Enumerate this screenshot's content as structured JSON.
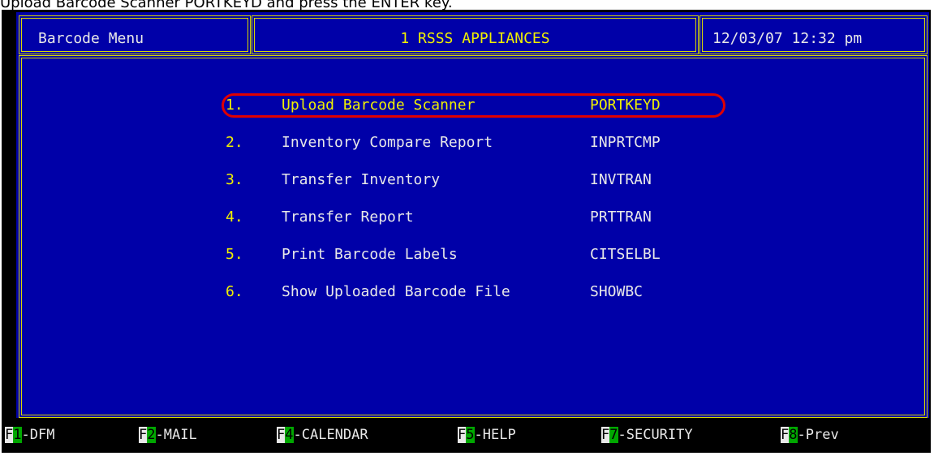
{
  "caption": "Upload Barcode Scanner PORTKEYD and press the ENTER key.",
  "header": {
    "menu_title": "Barcode Menu",
    "company": "1 RSSS APPLIANCES",
    "datetime": "12/03/07 12:32 pm"
  },
  "menu": {
    "items": [
      {
        "num": "1.",
        "label": "Upload Barcode Scanner",
        "code": "PORTKEYD",
        "selected": true
      },
      {
        "num": "2.",
        "label": "Inventory Compare Report",
        "code": "INPRTCMP"
      },
      {
        "num": "3.",
        "label": "Transfer Inventory",
        "code": "INVTRAN"
      },
      {
        "num": "4.",
        "label": "Transfer Report",
        "code": "PRTTRAN"
      },
      {
        "num": "5.",
        "label": "Print Barcode Labels",
        "code": "CITSELBL"
      },
      {
        "num": "6.",
        "label": "Show Uploaded Barcode File",
        "code": "SHOWBC"
      }
    ]
  },
  "function_keys": [
    {
      "key": "F",
      "num": "1",
      "label": "-DFM"
    },
    {
      "key": "F",
      "num": "2",
      "label": "-MAIL"
    },
    {
      "key": "F",
      "num": "4",
      "label": "-CALENDAR"
    },
    {
      "key": "F",
      "num": "5",
      "label": "-HELP"
    },
    {
      "key": "F",
      "num": "7",
      "label": "-SECURITY"
    },
    {
      "key": "F",
      "num": "8",
      "label": "-Prev"
    }
  ],
  "colors": {
    "terminal_bg": "#0000a8",
    "border": "#d8d800",
    "highlight_text": "#f0f000",
    "normal_text": "#e8e8e8",
    "annotation_oval": "#e00000",
    "fkey_number_bg": "#00a800"
  }
}
